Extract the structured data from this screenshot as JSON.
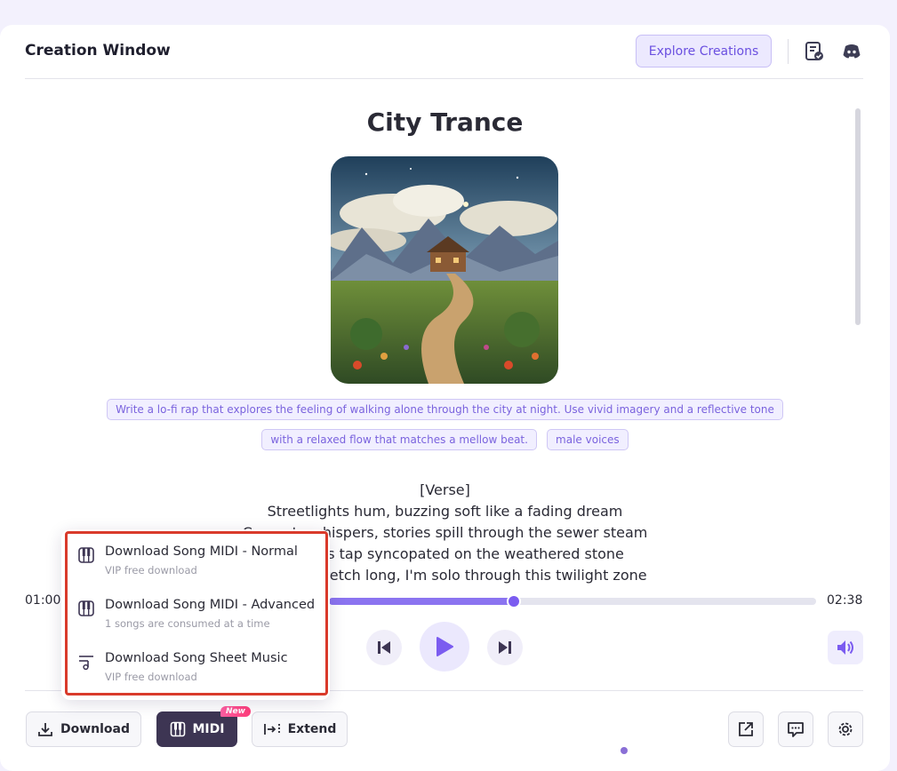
{
  "header": {
    "title": "Creation Window",
    "explore_label": "Explore Creations"
  },
  "song": {
    "title": "City Trance",
    "tags": [
      "Write a lo-fi rap that explores the feeling of walking alone through the city at night. Use vivid imagery and a reflective tone",
      "with a relaxed flow that matches a mellow beat.",
      "male voices"
    ],
    "lyrics": [
      "[Verse]",
      "Streetlights hum, buzzing soft like a fading dream",
      "Concrete whispers, stories spill through the sewer steam",
      "Footsteps tap syncopated on the weathered stone",
      "Shadows stretch long, I'm solo through this twilight zone"
    ]
  },
  "player": {
    "current_time": "01:00",
    "total_time": "02:38",
    "progress": 0.38
  },
  "menu": {
    "items": [
      {
        "title": "Download Song MIDI - Normal",
        "subtitle": "VIP free download",
        "icon": "piano-icon"
      },
      {
        "title": "Download Song MIDI - Advanced",
        "subtitle": "1 songs are consumed at a time",
        "icon": "piano-icon"
      },
      {
        "title": "Download Song Sheet Music",
        "subtitle": "VIP free download",
        "icon": "sheet-music-icon"
      }
    ]
  },
  "toolbar": {
    "download_label": "Download",
    "midi_label": "MIDI",
    "new_badge": "New",
    "extend_label": "Extend"
  },
  "colors": {
    "accent": "#7b5cf0",
    "dark_button": "#3d3553",
    "highlight": "#d93a2b"
  }
}
